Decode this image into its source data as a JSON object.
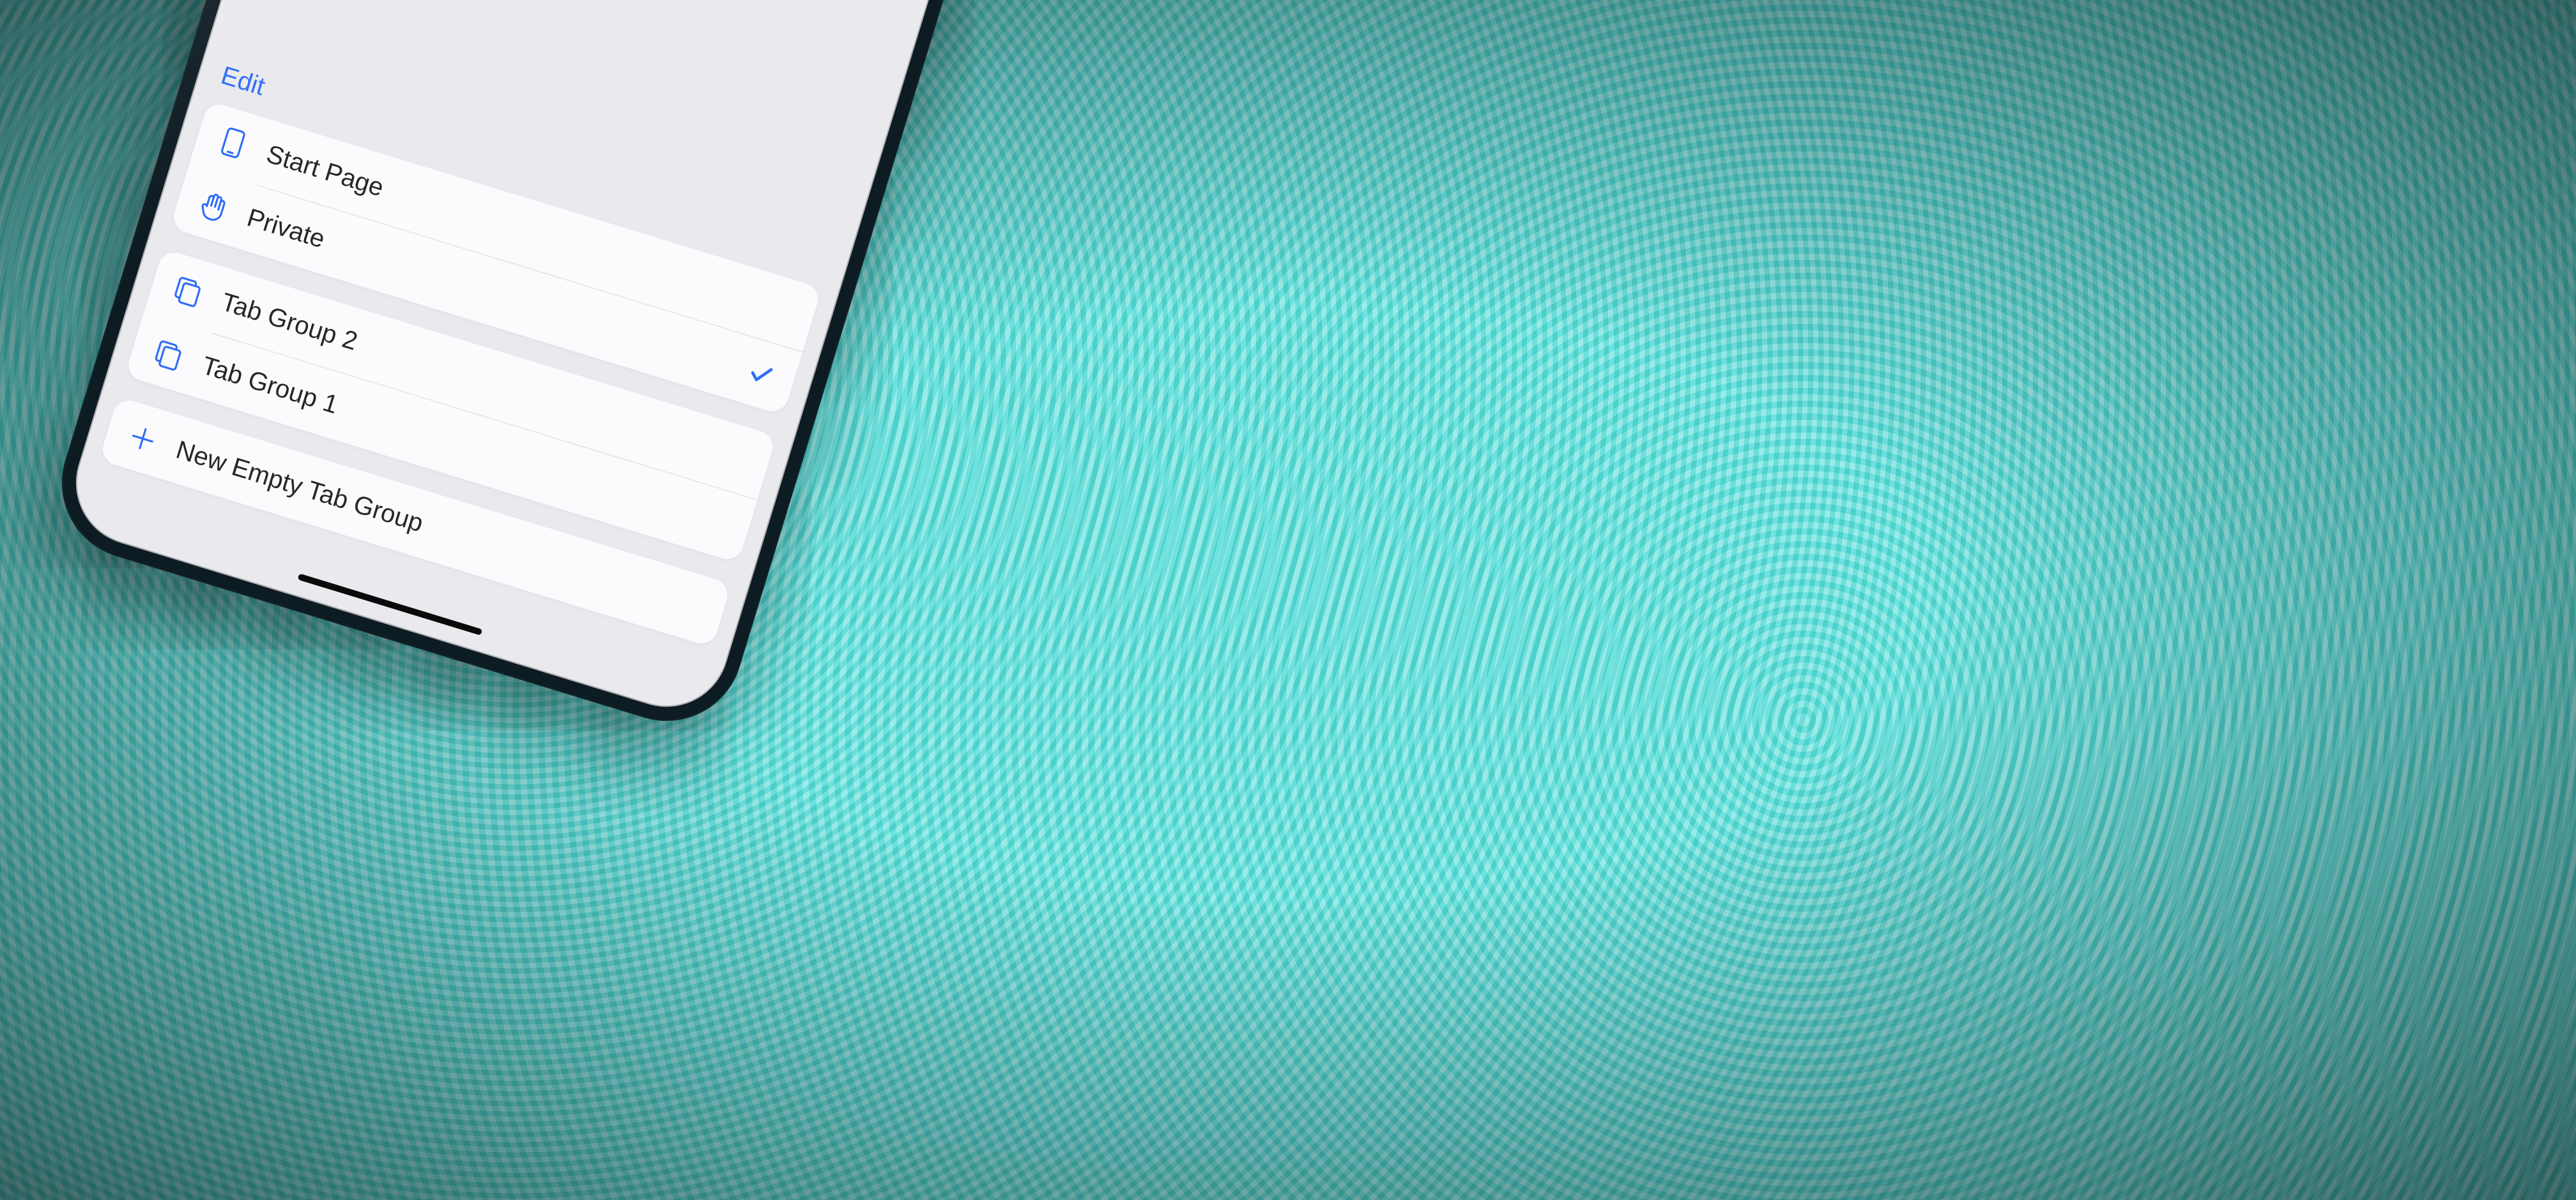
{
  "edit_label": "Edit",
  "sections": [
    {
      "rows": [
        {
          "icon": "phone-icon",
          "label": "Start Page",
          "selected": false
        },
        {
          "icon": "hand-icon",
          "label": "Private",
          "selected": true
        }
      ]
    },
    {
      "rows": [
        {
          "icon": "tabs-icon",
          "label": "Tab Group 2",
          "selected": false
        },
        {
          "icon": "tabs-icon",
          "label": "Tab Group 1",
          "selected": false
        }
      ]
    },
    {
      "rows": [
        {
          "icon": "plus-icon",
          "label": "New Empty Tab Group",
          "selected": false
        }
      ]
    }
  ],
  "colors": {
    "accent": "#2f6df6"
  }
}
